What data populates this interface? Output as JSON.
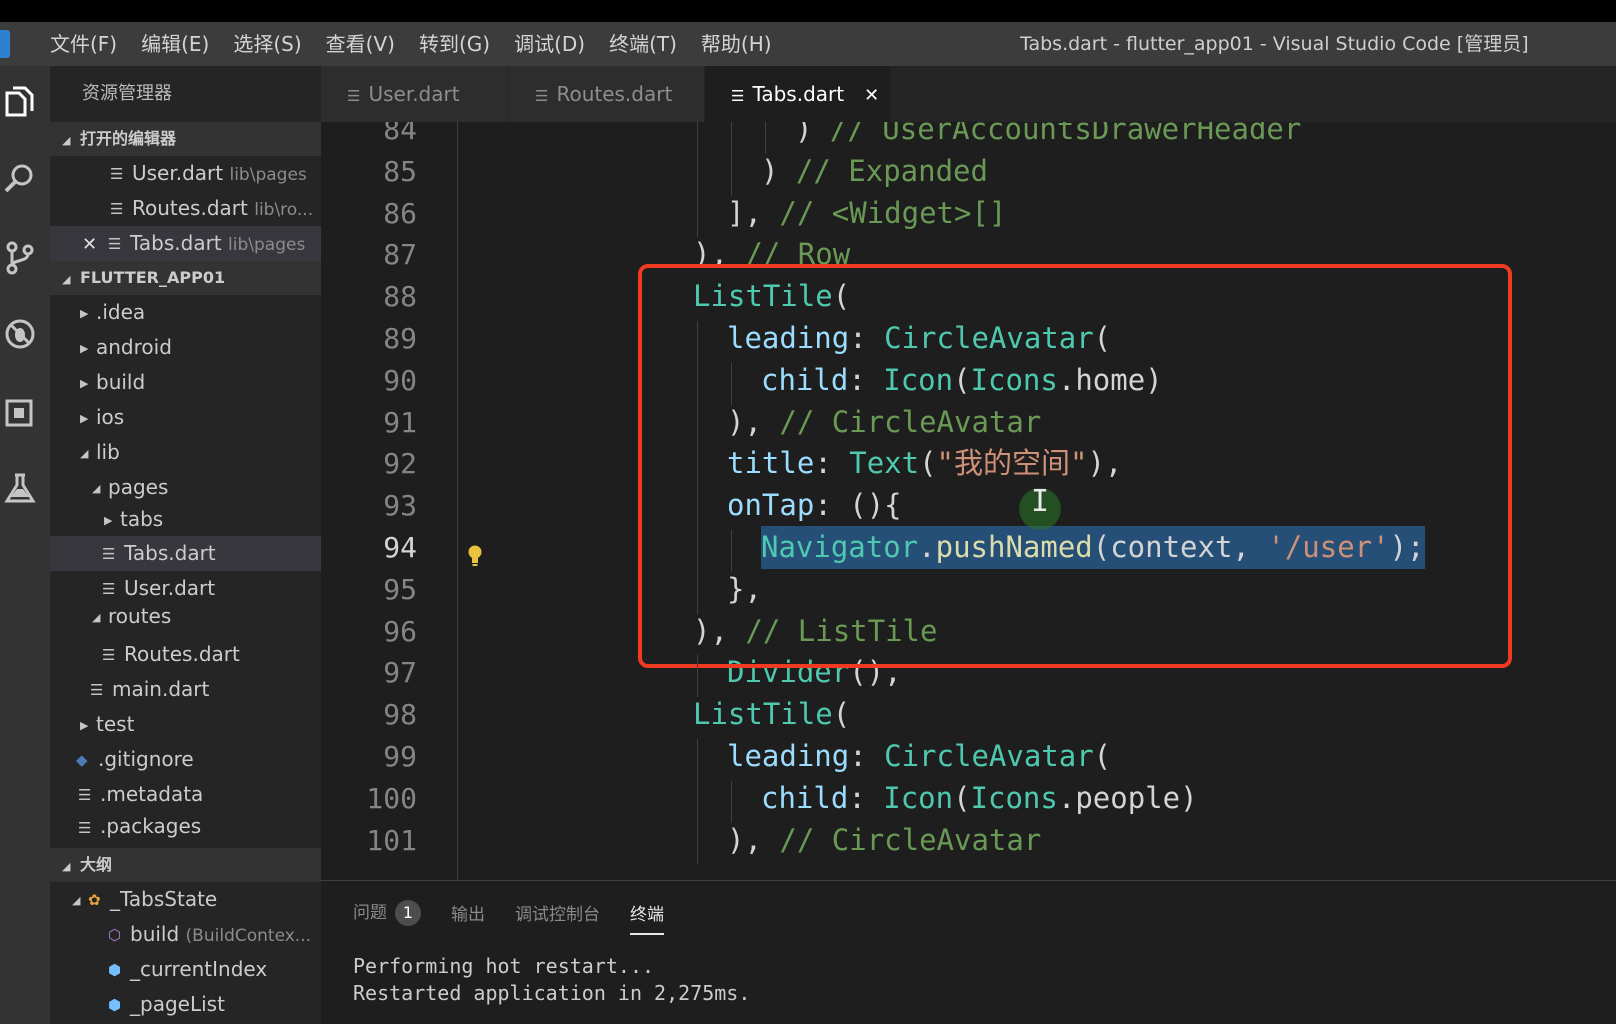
{
  "menubar": {
    "items": [
      "文件(F)",
      "编辑(E)",
      "选择(S)",
      "查看(V)",
      "转到(G)",
      "调试(D)",
      "终端(T)",
      "帮助(H)"
    ],
    "window_title": "Tabs.dart - flutter_app01 - Visual Studio Code [管理员]"
  },
  "activity_icons": [
    "files-icon",
    "search-icon",
    "source-control-icon",
    "debug-icon",
    "extensions-icon",
    "test-icon"
  ],
  "sidebar": {
    "title": "资源管理器",
    "open_editors": {
      "header": "打开的编辑器",
      "items": [
        {
          "name": "User.dart",
          "hint": "lib\\pages"
        },
        {
          "name": "Routes.dart",
          "hint": "lib\\ro..."
        },
        {
          "name": "Tabs.dart",
          "hint": "lib\\pages"
        }
      ]
    },
    "project": {
      "header": "FLUTTER_APP01",
      "items": [
        ".idea",
        "android",
        "build",
        "ios",
        "lib",
        "pages",
        "tabs",
        "Tabs.dart",
        "User.dart",
        "routes",
        "Routes.dart",
        "main.dart",
        "test",
        ".gitignore",
        ".metadata",
        ".packages"
      ]
    },
    "outline": {
      "header": "大纲",
      "items": [
        "_TabsState",
        "build",
        "(BuildContex...",
        "_currentIndex",
        "_pageList"
      ]
    }
  },
  "tabs": [
    {
      "label": "User.dart",
      "active": false
    },
    {
      "label": "Routes.dart",
      "active": false
    },
    {
      "label": "Tabs.dart",
      "active": true
    }
  ],
  "editor": {
    "current_line": 94,
    "lines": [
      {
        "n": "84",
        "indent": 3,
        "tokens": [
          [
            "p",
            ") "
          ],
          [
            "c",
            "// UserAccountsDrawerHeader"
          ]
        ]
      },
      {
        "n": "85",
        "indent": 2,
        "tokens": [
          [
            "p",
            ") "
          ],
          [
            "c",
            "// Expanded"
          ]
        ]
      },
      {
        "n": "86",
        "indent": 1,
        "tokens": [
          [
            "p",
            "], "
          ],
          [
            "c",
            "// <Widget>[]"
          ]
        ]
      },
      {
        "n": "87",
        "indent": 0,
        "tokens": [
          [
            "p",
            "), "
          ],
          [
            "c",
            "// Row"
          ]
        ]
      },
      {
        "n": "88",
        "indent": 0,
        "tokens": [
          [
            "k",
            "ListTile"
          ],
          [
            "p",
            "("
          ]
        ]
      },
      {
        "n": "89",
        "indent": 1,
        "tokens": [
          [
            "v",
            "leading"
          ],
          [
            "p",
            ": "
          ],
          [
            "k",
            "CircleAvatar"
          ],
          [
            "p",
            "("
          ]
        ]
      },
      {
        "n": "90",
        "indent": 2,
        "tokens": [
          [
            "v",
            "child"
          ],
          [
            "p",
            ": "
          ],
          [
            "k",
            "Icon"
          ],
          [
            "p",
            "("
          ],
          [
            "k",
            "Icons"
          ],
          [
            "p",
            ".home)"
          ]
        ]
      },
      {
        "n": "91",
        "indent": 1,
        "tokens": [
          [
            "p",
            "), "
          ],
          [
            "c",
            "// CircleAvatar"
          ]
        ]
      },
      {
        "n": "92",
        "indent": 1,
        "tokens": [
          [
            "v",
            "title"
          ],
          [
            "p",
            ": "
          ],
          [
            "k",
            "Text"
          ],
          [
            "p",
            "("
          ],
          [
            "s",
            "\"我的空间\""
          ],
          [
            "p",
            "),"
          ]
        ]
      },
      {
        "n": "93",
        "indent": 1,
        "tokens": [
          [
            "v",
            "onTap"
          ],
          [
            "p",
            ": (){"
          ]
        ]
      },
      {
        "n": "94",
        "indent": 2,
        "sel": true,
        "tokens": [
          [
            "k",
            "Navigator"
          ],
          [
            "p",
            "."
          ],
          [
            "f",
            "pushNamed"
          ],
          [
            "p",
            "(context, "
          ],
          [
            "s",
            "'/user'"
          ],
          [
            "p",
            ");"
          ]
        ]
      },
      {
        "n": "95",
        "indent": 1,
        "tokens": [
          [
            "p",
            "},"
          ]
        ]
      },
      {
        "n": "96",
        "indent": 0,
        "tokens": [
          [
            "p",
            "), "
          ],
          [
            "c",
            "// ListTile"
          ]
        ]
      },
      {
        "n": "97",
        "indent": 1,
        "tokens": [
          [
            "k",
            "Divider"
          ],
          [
            "p",
            "(),"
          ]
        ]
      },
      {
        "n": "98",
        "indent": 0,
        "tokens": [
          [
            "k",
            "ListTile"
          ],
          [
            "p",
            "("
          ]
        ]
      },
      {
        "n": "99",
        "indent": 1,
        "tokens": [
          [
            "v",
            "leading"
          ],
          [
            "p",
            ": "
          ],
          [
            "k",
            "CircleAvatar"
          ],
          [
            "p",
            "("
          ]
        ]
      },
      {
        "n": "100",
        "indent": 2,
        "tokens": [
          [
            "v",
            "child"
          ],
          [
            "p",
            ": "
          ],
          [
            "k",
            "Icon"
          ],
          [
            "p",
            "("
          ],
          [
            "k",
            "Icons"
          ],
          [
            "p",
            ".people)"
          ]
        ]
      },
      {
        "n": "101",
        "indent": 1,
        "tokens": [
          [
            "p",
            "), "
          ],
          [
            "c",
            "// CircleAvatar"
          ]
        ]
      }
    ]
  },
  "panel": {
    "tabs": [
      {
        "label": "问题",
        "badge": "1"
      },
      {
        "label": "输出"
      },
      {
        "label": "调试控制台"
      },
      {
        "label": "终端",
        "active": true
      }
    ],
    "terminal_lines": [
      "Performing hot restart...",
      "Restarted application in 2,275ms."
    ]
  },
  "colors": {
    "highlight_box": "#f03a22",
    "selection": "#264f78",
    "class_token": "#4ec9b0",
    "property_token": "#9cdcfe",
    "string_token": "#ce9178",
    "comment_token": "#6a9955"
  }
}
